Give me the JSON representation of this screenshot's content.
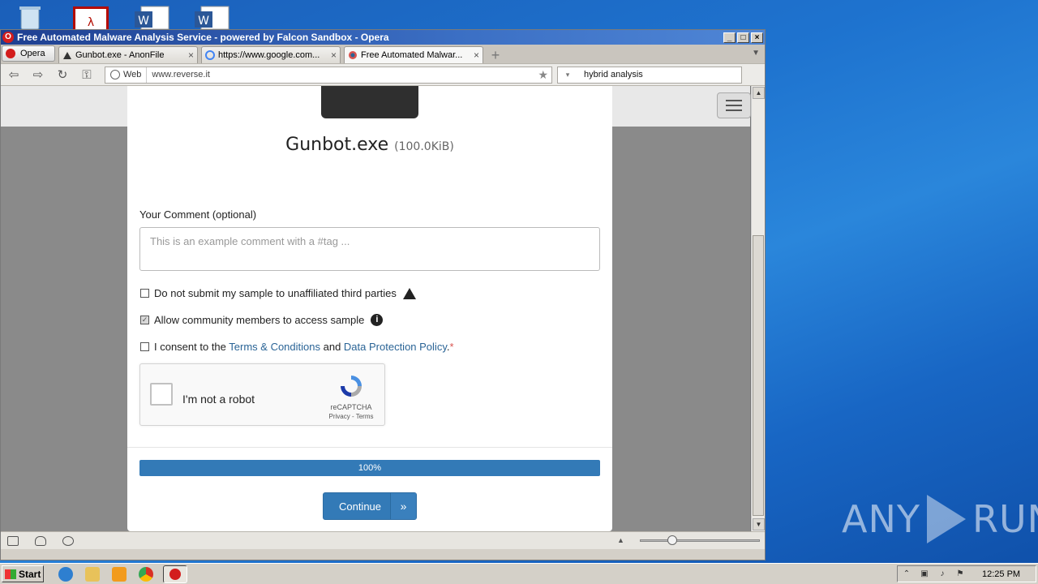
{
  "window": {
    "title": "Free Automated Malware Analysis Service - powered by Falcon Sandbox - Opera",
    "controls": {
      "minimize": "_",
      "maximize": "□",
      "close": "×"
    }
  },
  "tabs": {
    "opera_menu": "Opera",
    "items": [
      {
        "label": "Gunbot.exe - AnonFile",
        "close": "×"
      },
      {
        "label": "https://www.google.com...",
        "close": "×"
      },
      {
        "label": "Free Automated Malwar...",
        "close": "×",
        "active": true
      }
    ],
    "new_tab": "+"
  },
  "navbar": {
    "web_label": "Web",
    "url": "www.reverse.it",
    "search_value": "hybrid analysis"
  },
  "modal": {
    "file_name": "Gunbot.exe",
    "file_size": "(100.0KiB)",
    "comment_label": "Your Comment (optional)",
    "comment_placeholder": "This is an example comment with a #tag ...",
    "opt_third_parties": {
      "label": "Do not submit my sample to unaffiliated third parties",
      "checked": false
    },
    "opt_community": {
      "label": "Allow community members to access sample",
      "checked": true
    },
    "consent": {
      "prefix": "I consent to the ",
      "terms_link": "Terms & Conditions",
      "middle": " and ",
      "policy_link": "Data Protection Policy",
      "suffix": ".",
      "required_mark": "*",
      "checked": false
    },
    "captcha": {
      "label": "I'm not a robot",
      "brand": "reCAPTCHA",
      "links": "Privacy - Terms"
    },
    "progress": {
      "value": 100,
      "label": "100%"
    },
    "continue_label": "Continue",
    "continue_icon": "»"
  },
  "statusbar": {
    "zoom_fraction": 0.27
  },
  "taskbar": {
    "start_label": "Start",
    "clock": "12:25 PM"
  },
  "watermark": {
    "left": "ANY",
    "right": "RUN"
  },
  "colors": {
    "accent": "#337ab7",
    "link": "#2a6496",
    "required": "#d9534f",
    "title_bar": "#1e3f91"
  }
}
